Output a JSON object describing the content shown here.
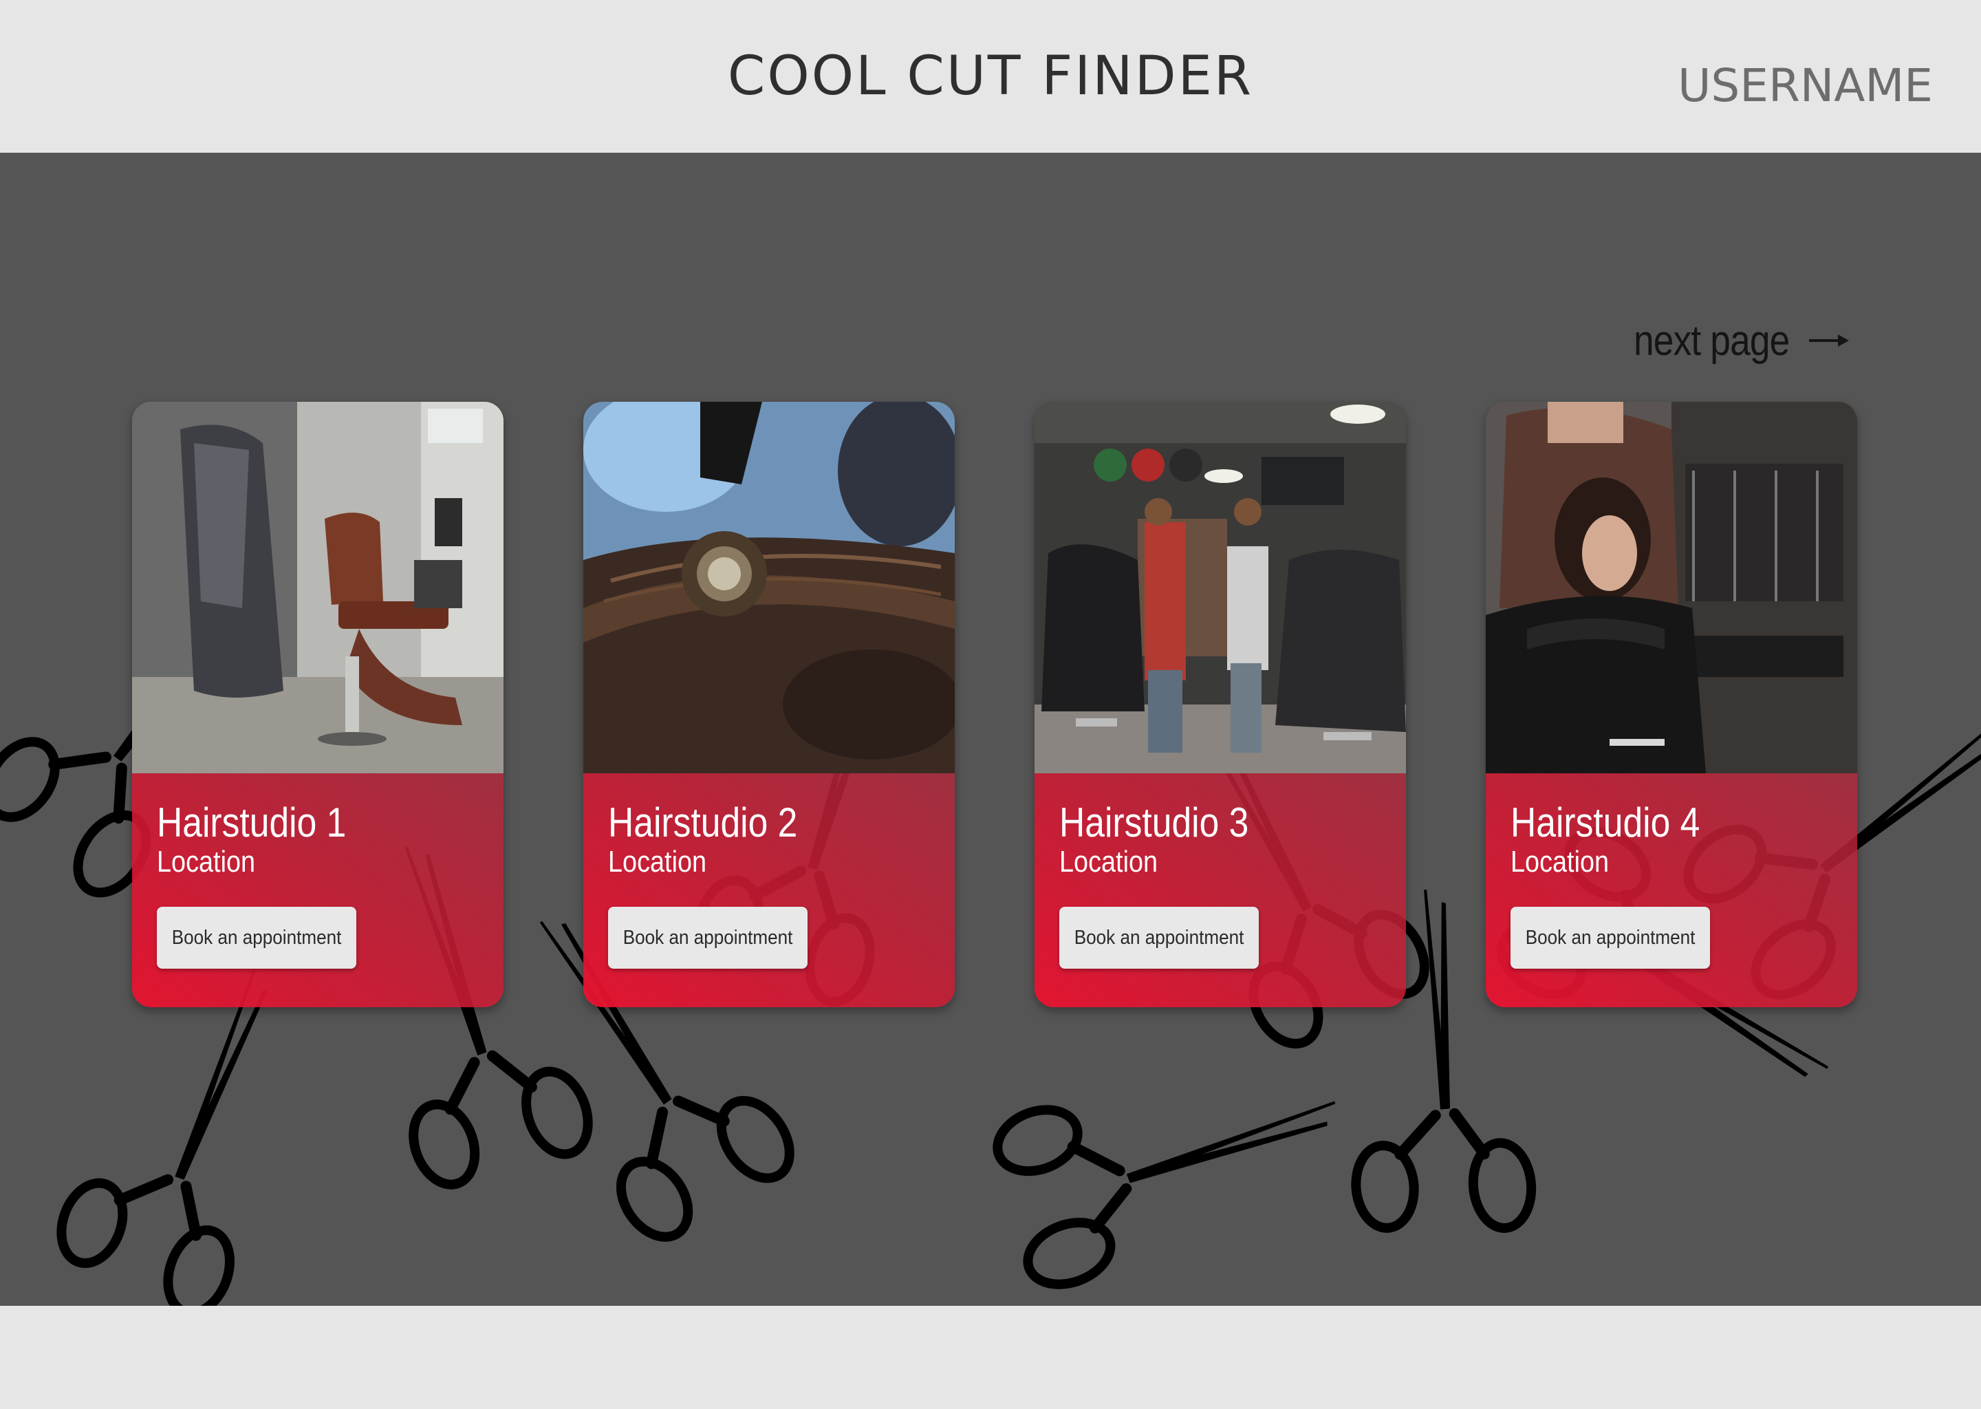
{
  "header": {
    "title": "COOL CUT FINDER",
    "username": "USERNAME"
  },
  "pagination": {
    "next_label": "next page",
    "next_icon": "arrow-right-icon"
  },
  "studios": [
    {
      "name": "Hairstudio 1",
      "location": "Location",
      "button_label": "Book an appointment",
      "photo": "barbershop-chairs-photo"
    },
    {
      "name": "Hairstudio 2",
      "location": "Location",
      "button_label": "Book an appointment",
      "photo": "hair-blowdry-brush-photo"
    },
    {
      "name": "Hairstudio 3",
      "location": "Location",
      "button_label": "Book an appointment",
      "photo": "barbers-cutting-hair-photo"
    },
    {
      "name": "Hairstudio 4",
      "location": "Location",
      "button_label": "Book an appointment",
      "photo": "stylist-with-client-photo"
    }
  ],
  "colors": {
    "header_bg": "#e6e6e6",
    "main_bg": "#555555",
    "card_accent": "#e0142f",
    "button_bg": "#e8e8e8"
  }
}
